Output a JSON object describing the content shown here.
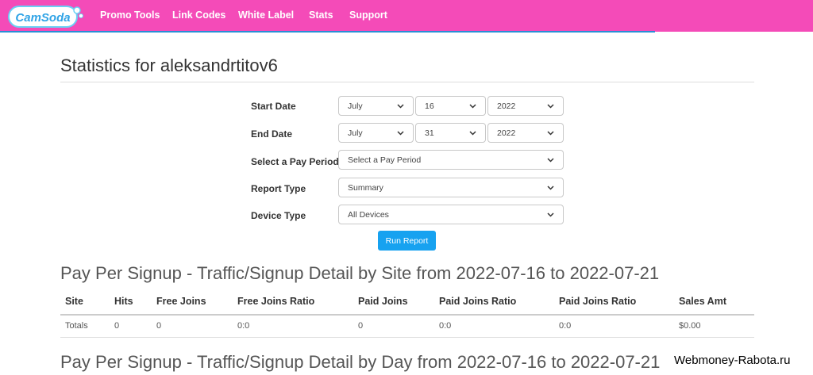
{
  "brand": {
    "logo_text": "CamSoda",
    "header_color": "#f44bb8",
    "accent": "#2a8ed6"
  },
  "nav": {
    "items": [
      {
        "label": "Promo Tools"
      },
      {
        "label": "Link Codes"
      },
      {
        "label": "White Label"
      },
      {
        "label": "Stats"
      },
      {
        "label": "Support"
      }
    ]
  },
  "page": {
    "title": "Statistics for aleksandrtitov6"
  },
  "form": {
    "start_date_label": "Start Date",
    "start_month": "July",
    "start_day": "16",
    "start_year": "2022",
    "end_date_label": "End Date",
    "end_month": "July",
    "end_day": "31",
    "end_year": "2022",
    "pay_period_label": "Select a Pay Period",
    "pay_period_value": "Select a Pay Period",
    "report_type_label": "Report Type",
    "report_type_value": "Summary",
    "device_type_label": "Device Type",
    "device_type_value": "All Devices",
    "run_button": "Run Report",
    "run_button_color": "#17a2f0"
  },
  "site_table": {
    "title": "Pay Per Signup - Traffic/Signup Detail by Site from 2022-07-16 to 2022-07-21",
    "headers": [
      "Site",
      "Hits",
      "Free Joins",
      "Free Joins Ratio",
      "Paid Joins",
      "Paid Joins Ratio",
      "Paid Joins Ratio",
      "Sales Amt"
    ],
    "totals_row": [
      "Totals",
      "0",
      "0",
      "0:0",
      "0",
      "0:0",
      "0:0",
      "$0.00"
    ]
  },
  "day_table": {
    "title": "Pay Per Signup - Traffic/Signup Detail by Day from 2022-07-16 to 2022-07-21"
  },
  "watermark": "Webmoney-Rabota.ru"
}
